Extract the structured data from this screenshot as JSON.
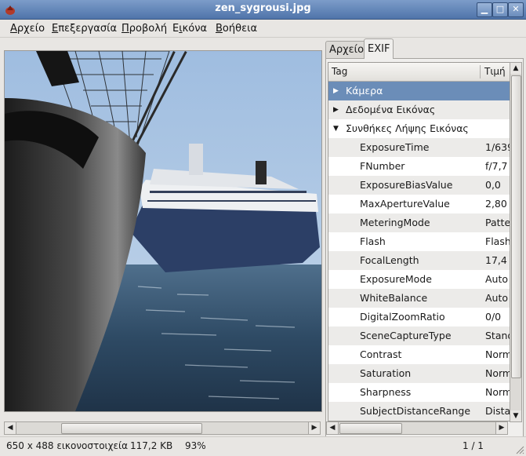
{
  "window": {
    "title": "zen_sygrousi.jpg"
  },
  "menu": [
    {
      "label": "Αρχείο",
      "mnemonic": "Α",
      "rest": "ρχείο"
    },
    {
      "label": "Επεξεργασία",
      "mnemonic": "Ε",
      "rest": "πεξεργασία"
    },
    {
      "label": "Προβολή",
      "mnemonic": "Π",
      "rest": "ροβολή"
    },
    {
      "label": "Εικόνα",
      "pre": "Ε",
      "mnemonic": "ι",
      "rest": "κόνα"
    },
    {
      "label": "Βοήθεια",
      "mnemonic": "Β",
      "rest": "οήθεια"
    }
  ],
  "tabs": {
    "file": "Αρχείο",
    "exif": "EXIF"
  },
  "exif": {
    "headers": {
      "tag": "Tag",
      "value": "Τιμή"
    },
    "groups": {
      "camera": "Κάμερα",
      "image_data": "Δεδομένα Εικόνας",
      "capture": "Συνθήκες Λήψης Εικόνας"
    },
    "rows": [
      {
        "tag": "ExposureTime",
        "value": "1/639"
      },
      {
        "tag": "FNumber",
        "value": "f/7,7"
      },
      {
        "tag": "ExposureBiasValue",
        "value": "0,0"
      },
      {
        "tag": "MaxApertureValue",
        "value": "2,80"
      },
      {
        "tag": "MeteringMode",
        "value": "Patte"
      },
      {
        "tag": "Flash",
        "value": "Flash"
      },
      {
        "tag": "FocalLength",
        "value": "17,4"
      },
      {
        "tag": "ExposureMode",
        "value": "Auto"
      },
      {
        "tag": "WhiteBalance",
        "value": "Auto"
      },
      {
        "tag": "DigitalZoomRatio",
        "value": "0/0"
      },
      {
        "tag": "SceneCaptureType",
        "value": "Stand"
      },
      {
        "tag": "Contrast",
        "value": "Norm"
      },
      {
        "tag": "Saturation",
        "value": "Norm"
      },
      {
        "tag": "Sharpness",
        "value": "Norm"
      },
      {
        "tag": "SubjectDistanceRange",
        "value": "Dista"
      }
    ]
  },
  "status": {
    "dimensions": "650 x 488 εικονοστοιχεία",
    "size": "117,2 KB",
    "zoom": "93%",
    "page": "1 / 1"
  },
  "icons": {
    "app": "eye-of-gnome-icon",
    "minimize": "minimize-icon",
    "maximize": "maximize-icon",
    "close": "close-icon"
  },
  "colors": {
    "titlebar": "#5b7fb4",
    "selection": "#6b8db8"
  }
}
